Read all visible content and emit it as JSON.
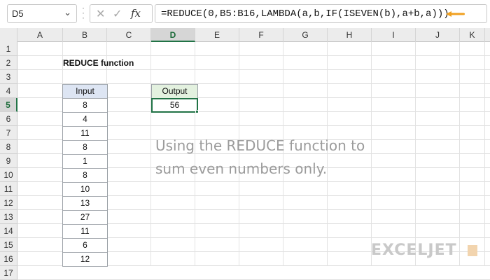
{
  "namebox": {
    "value": "D5"
  },
  "formula_bar": {
    "cancel_icon": "close-icon",
    "enter_icon": "check-icon",
    "fx_label": "fx",
    "formula": "=REDUCE(0,B5:B16,LAMBDA(a,b,IF(ISEVEN(b),a+b,a)))",
    "arrow_color": "#F0A020"
  },
  "columns": [
    "A",
    "B",
    "C",
    "D",
    "E",
    "F",
    "G",
    "H",
    "I",
    "J",
    "K"
  ],
  "selected_column": "D",
  "rows": [
    "1",
    "2",
    "3",
    "4",
    "5",
    "6",
    "7",
    "8",
    "9",
    "10",
    "11",
    "12",
    "13",
    "14",
    "15",
    "16",
    "17"
  ],
  "selected_row": "5",
  "sheet": {
    "title": "REDUCE function",
    "input_header": "Input",
    "inputs": [
      "8",
      "4",
      "11",
      "8",
      "1",
      "8",
      "10",
      "13",
      "27",
      "11",
      "6",
      "12"
    ],
    "output_header": "Output",
    "output_value": "56"
  },
  "note": {
    "line1": "Using the REDUCE function to",
    "line2": "sum even numbers only."
  },
  "branding": {
    "logo_text": "EXCELJET"
  },
  "colors": {
    "input_header_bg": "#DDE5F3",
    "output_header_bg": "#E3F1DF",
    "selection": "#217346"
  }
}
